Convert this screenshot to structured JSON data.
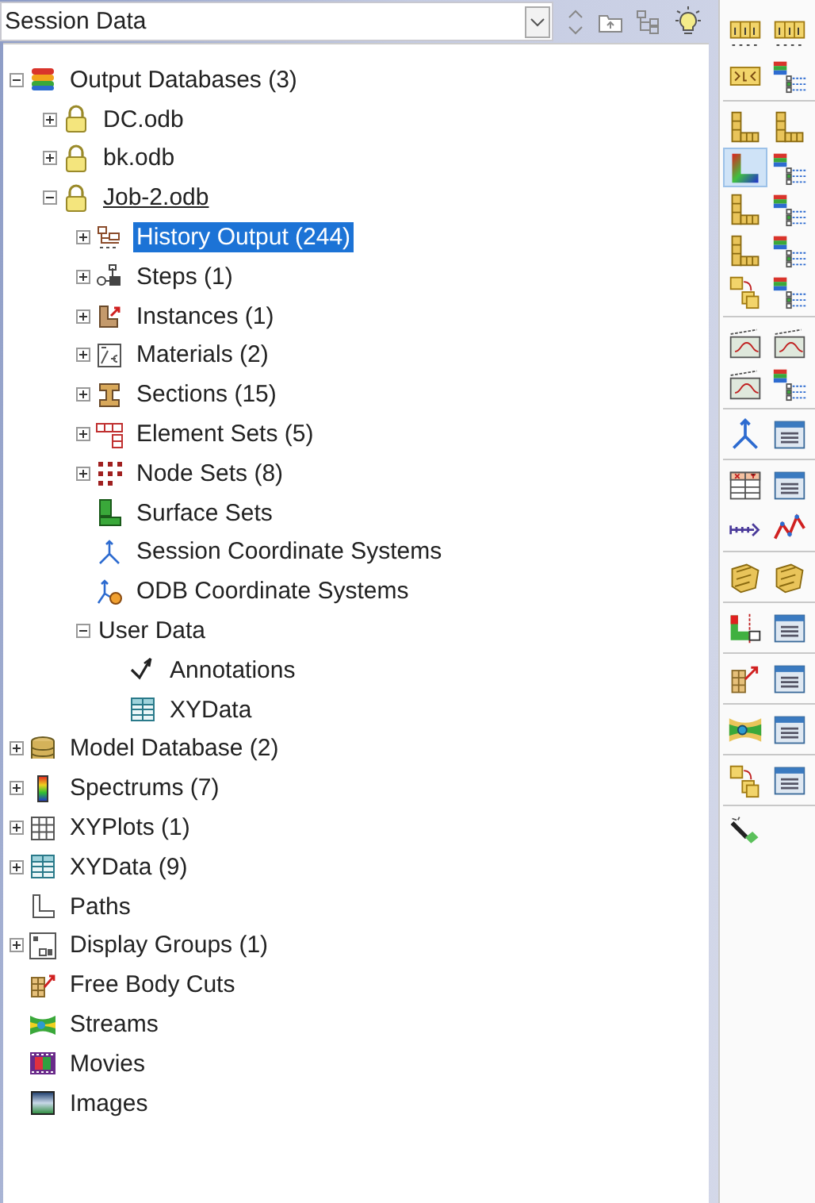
{
  "session_selector": {
    "value": "Session Data"
  },
  "tree": [
    {
      "label": "Output Databases (3)",
      "kind": "database",
      "expanded": true,
      "selected": false,
      "children": [
        {
          "label": "DC.odb",
          "kind": "odb",
          "expanded": false,
          "selected": false,
          "current": false
        },
        {
          "label": "bk.odb",
          "kind": "odb",
          "expanded": false,
          "selected": false,
          "current": false
        },
        {
          "label": "Job-2.odb",
          "kind": "odb",
          "expanded": true,
          "selected": false,
          "current": true,
          "children": [
            {
              "label": "History Output (244)",
              "kind": "history",
              "expanded": false,
              "selected": true
            },
            {
              "label": "Steps (1)",
              "kind": "steps",
              "expanded": false,
              "selected": false
            },
            {
              "label": "Instances (1)",
              "kind": "instances",
              "expanded": false,
              "selected": false
            },
            {
              "label": "Materials (2)",
              "kind": "materials",
              "expanded": false,
              "selected": false
            },
            {
              "label": "Sections (15)",
              "kind": "sections",
              "expanded": false,
              "selected": false
            },
            {
              "label": "Element Sets (5)",
              "kind": "elements",
              "expanded": false,
              "selected": false
            },
            {
              "label": "Node Sets (8)",
              "kind": "nodes",
              "expanded": false,
              "selected": false
            },
            {
              "label": "Surface Sets",
              "kind": "surfaces",
              "selected": false
            },
            {
              "label": "Session Coordinate Systems",
              "kind": "csys",
              "selected": false
            },
            {
              "label": "ODB Coordinate Systems",
              "kind": "odbcsys",
              "selected": false
            },
            {
              "label": "User Data",
              "kind": "none",
              "expanded": true,
              "selected": false,
              "children": [
                {
                  "label": "Annotations",
                  "kind": "annotations",
                  "selected": false
                },
                {
                  "label": "XYData",
                  "kind": "xydata",
                  "selected": false
                }
              ]
            }
          ]
        }
      ]
    },
    {
      "label": "Model Database (2)",
      "kind": "modeldb",
      "expanded": false,
      "selected": false
    },
    {
      "label": "Spectrums (7)",
      "kind": "spectrum",
      "expanded": false,
      "selected": false
    },
    {
      "label": "XYPlots (1)",
      "kind": "xyplots",
      "expanded": false,
      "selected": false
    },
    {
      "label": "XYData (9)",
      "kind": "xydata",
      "expanded": false,
      "selected": false
    },
    {
      "label": "Paths",
      "kind": "paths",
      "selected": false
    },
    {
      "label": "Display Groups (1)",
      "kind": "display",
      "expanded": false,
      "selected": false
    },
    {
      "label": "Free Body Cuts",
      "kind": "freebody",
      "selected": false
    },
    {
      "label": "Streams",
      "kind": "streams",
      "selected": false
    },
    {
      "label": "Movies",
      "kind": "movies",
      "selected": false
    },
    {
      "label": "Images",
      "kind": "images",
      "selected": false
    }
  ],
  "toolbar": [
    {
      "buttons": [
        {
          "kind": "numbers",
          "selected": false
        },
        {
          "kind": "numbers",
          "selected": false
        },
        {
          "kind": "bars",
          "selected": false
        },
        {
          "kind": "list",
          "selected": false
        }
      ]
    },
    {
      "buttons": [
        {
          "kind": "blocks",
          "selected": false
        },
        {
          "kind": "blocks",
          "selected": false
        },
        {
          "kind": "contour",
          "selected": true
        },
        {
          "kind": "list",
          "selected": false
        },
        {
          "kind": "blocks",
          "selected": false
        },
        {
          "kind": "list",
          "selected": false
        },
        {
          "kind": "blocks",
          "selected": false
        },
        {
          "kind": "list",
          "selected": false
        },
        {
          "kind": "copy",
          "selected": false
        },
        {
          "kind": "list",
          "selected": false
        }
      ]
    },
    {
      "buttons": [
        {
          "kind": "film",
          "selected": false
        },
        {
          "kind": "film",
          "selected": false
        },
        {
          "kind": "film",
          "selected": false
        },
        {
          "kind": "list",
          "selected": false
        }
      ]
    },
    {
      "buttons": [
        {
          "kind": "axes",
          "selected": false
        },
        {
          "kind": "window",
          "selected": false
        }
      ]
    },
    {
      "buttons": [
        {
          "kind": "table",
          "selected": false
        },
        {
          "kind": "window",
          "selected": false
        },
        {
          "kind": "path",
          "selected": false
        },
        {
          "kind": "line",
          "selected": false
        }
      ]
    },
    {
      "buttons": [
        {
          "kind": "plates",
          "selected": false
        },
        {
          "kind": "plates",
          "selected": false
        }
      ]
    },
    {
      "buttons": [
        {
          "kind": "probe",
          "selected": false
        },
        {
          "kind": "window",
          "selected": false
        }
      ]
    },
    {
      "buttons": [
        {
          "kind": "freebody",
          "selected": false
        },
        {
          "kind": "window",
          "selected": false
        }
      ]
    },
    {
      "buttons": [
        {
          "kind": "stream",
          "selected": false
        },
        {
          "kind": "window",
          "selected": false
        }
      ]
    },
    {
      "buttons": [
        {
          "kind": "copy",
          "selected": false
        },
        {
          "kind": "window",
          "selected": false
        }
      ]
    },
    {
      "buttons": [
        {
          "kind": "wand",
          "selected": false
        }
      ]
    }
  ]
}
